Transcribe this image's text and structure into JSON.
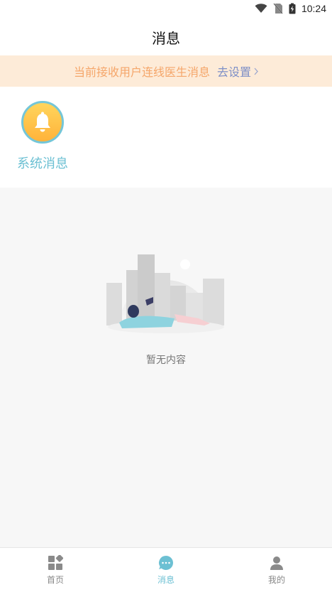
{
  "status_bar": {
    "time": "10:24"
  },
  "header": {
    "title": "消息"
  },
  "banner": {
    "text": "当前接收用户连线医生消息",
    "link": "去设置"
  },
  "system_message": {
    "label": "系统消息"
  },
  "empty_state": {
    "text": "暂无内容"
  },
  "tabs": [
    {
      "label": "首页",
      "icon": "grid-icon",
      "active": false
    },
    {
      "label": "消息",
      "icon": "chat-bubble-icon",
      "active": true
    },
    {
      "label": "我的",
      "icon": "user-icon",
      "active": false
    }
  ],
  "colors": {
    "accent": "#6cc0d3",
    "banner_bg": "#fdebd8",
    "banner_text": "#f5a66a",
    "banner_link": "#7d8fc7"
  }
}
